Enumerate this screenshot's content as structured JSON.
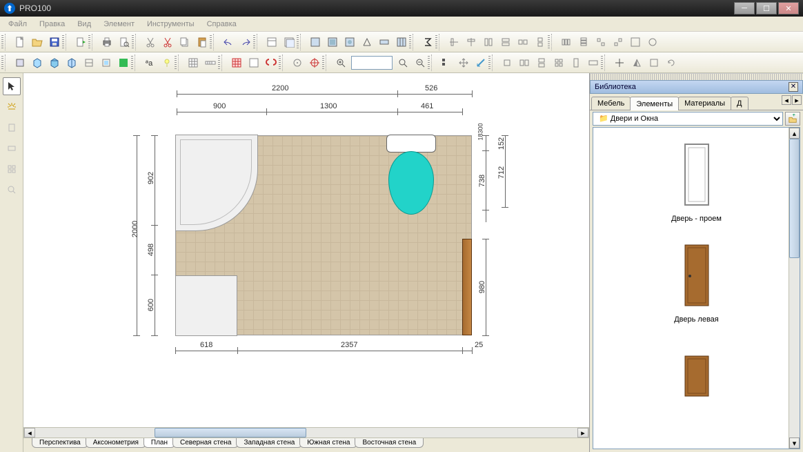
{
  "app": {
    "title": "PRO100"
  },
  "menu": [
    "Файл",
    "Правка",
    "Вид",
    "Элемент",
    "Инструменты",
    "Справка"
  ],
  "library": {
    "title": "Библиотека",
    "tabs": [
      "Мебель",
      "Элементы",
      "Материалы",
      "Д"
    ],
    "activeTab": 1,
    "folder": "Двери и Окна",
    "items": [
      {
        "label": "Дверь - проем"
      },
      {
        "label": "Дверь левая"
      }
    ]
  },
  "viewTabs": [
    "Перспектива",
    "Аксонометрия",
    "План",
    "Северная стена",
    "Западная стена",
    "Южная стена",
    "Восточная стена"
  ],
  "activeViewTab": 2,
  "dimensions": {
    "top1": "2200",
    "top1b": "526",
    "top2a": "900",
    "top2b": "1300",
    "top2c": "461",
    "left_total": "2000",
    "left_a": "902",
    "left_b": "498",
    "left_c": "600",
    "right_a": "152",
    "right_b": "712",
    "right_c": "738",
    "right_d": "980",
    "right_e": "18300",
    "bottom_a": "618",
    "bottom_b": "2357",
    "bottom_c": "25"
  }
}
